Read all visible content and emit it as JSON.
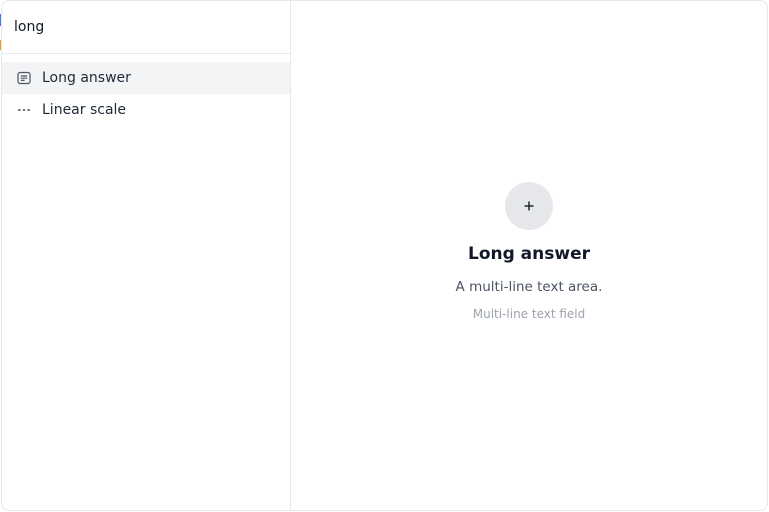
{
  "search": {
    "value": "long"
  },
  "results": [
    {
      "label": "Long answer",
      "icon": "text-lines-icon",
      "active": true
    },
    {
      "label": "Linear scale",
      "icon": "dashed-line-icon",
      "active": false
    }
  ],
  "preview": {
    "icon": "plus-icon",
    "title": "Long answer",
    "description": "A multi-line text area.",
    "hint": "Multi-line text field"
  },
  "colors": {
    "active_row": "#f3f4f6",
    "border": "#e5e7eb",
    "icon_circle": "#e5e7eb"
  }
}
